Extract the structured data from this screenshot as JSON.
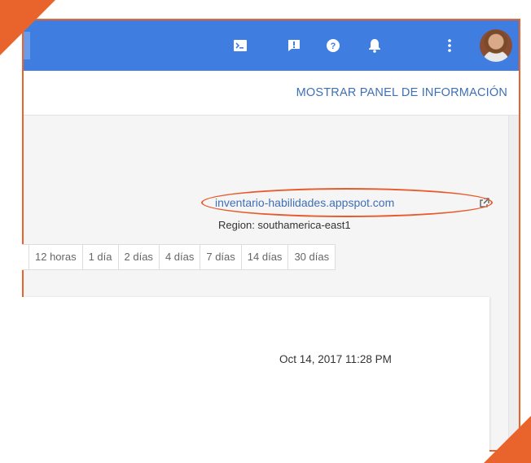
{
  "header": {
    "icons": [
      {
        "name": "cloud-shell-icon"
      },
      {
        "name": "notifications-alert-icon"
      },
      {
        "name": "help-icon"
      },
      {
        "name": "bell-icon"
      },
      {
        "name": "more-vert-icon"
      }
    ],
    "avatar": "user-avatar"
  },
  "info_bar": {
    "show_panel_label": "MOSTRAR PANEL DE INFORMACIÓN"
  },
  "app": {
    "url": "inventario-habilidades.appspot.com",
    "region": "Region: southamerica-east1"
  },
  "time_ranges": [
    "12 horas",
    "1 día",
    "2 días",
    "4 días",
    "7 días",
    "14 días",
    "30 días"
  ],
  "chart_card": {
    "timestamp": "Oct 14, 2017 11:28 PM"
  },
  "colors": {
    "topbar": "#3f7ee0",
    "link": "#3f6fb5",
    "annotation": "#e8642c"
  }
}
